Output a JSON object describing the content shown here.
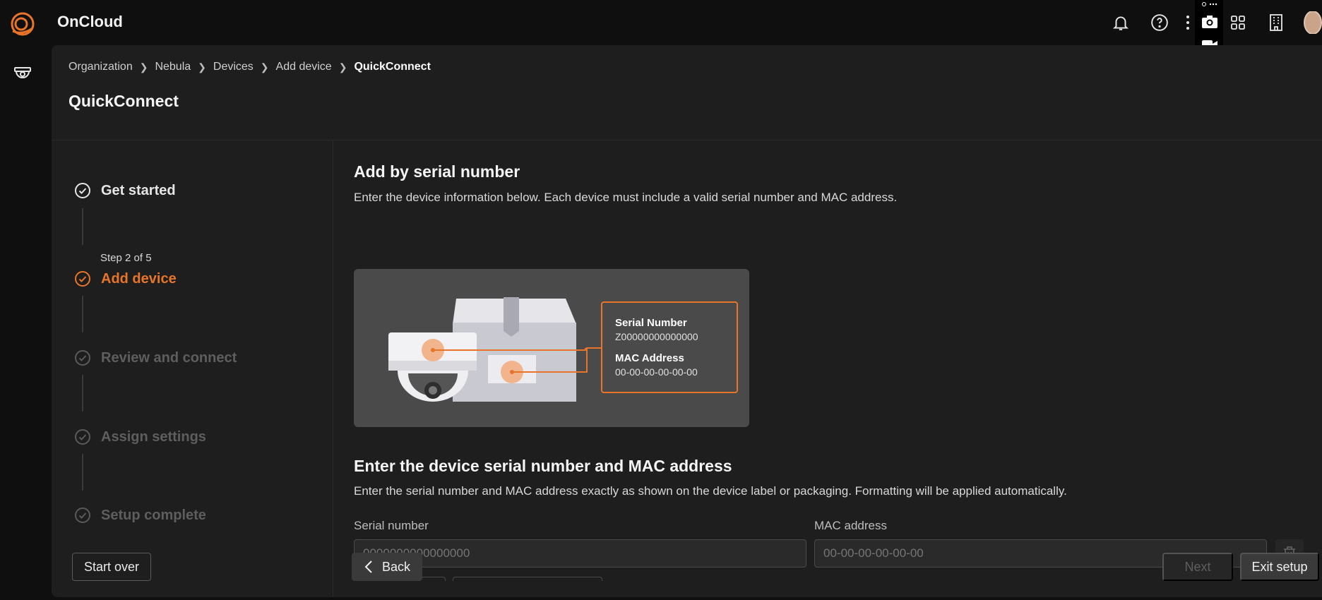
{
  "app": {
    "title": "OnCloud",
    "accent": "#e8742a"
  },
  "topbar": {
    "icons": [
      "bell-icon",
      "help-icon",
      "more-vertical-icon",
      "apps-grid-icon",
      "building-icon",
      "avatar"
    ]
  },
  "breadcrumb": {
    "items": [
      "Organization",
      "Nebula",
      "Devices",
      "Add device",
      "QuickConnect"
    ],
    "separator": ">"
  },
  "page": {
    "title": "QuickConnect"
  },
  "steps": {
    "items": [
      {
        "label": "Get started",
        "state": "done"
      },
      {
        "label": "Add device",
        "state": "active",
        "sub": "Step 2 of 5"
      },
      {
        "label": "Review and connect",
        "state": "pending"
      },
      {
        "label": "Assign settings",
        "state": "pending"
      },
      {
        "label": "Setup complete",
        "state": "pending"
      }
    ],
    "start_over": "Start over"
  },
  "section1": {
    "title": "Add by serial number",
    "desc": "Enter the device information below. Each device must include a valid serial number and MAC address."
  },
  "illustration": {
    "serial_title": "Serial Number",
    "serial_value": "Z00000000000000",
    "mac_title": "MAC Address",
    "mac_value": "00-00-00-00-00-00"
  },
  "section2": {
    "title": "Enter the device serial number and MAC address",
    "desc": "Enter the serial number and MAC address exactly as shown on the device label or packaging. Formatting will be applied automatically."
  },
  "form": {
    "serial_label": "Serial number",
    "serial_placeholder": "0000000000000000",
    "mac_label": "MAC address",
    "mac_placeholder": "00-00-00-00-00-00"
  },
  "footer": {
    "back": "Back",
    "next": "Next",
    "exit": "Exit setup"
  }
}
